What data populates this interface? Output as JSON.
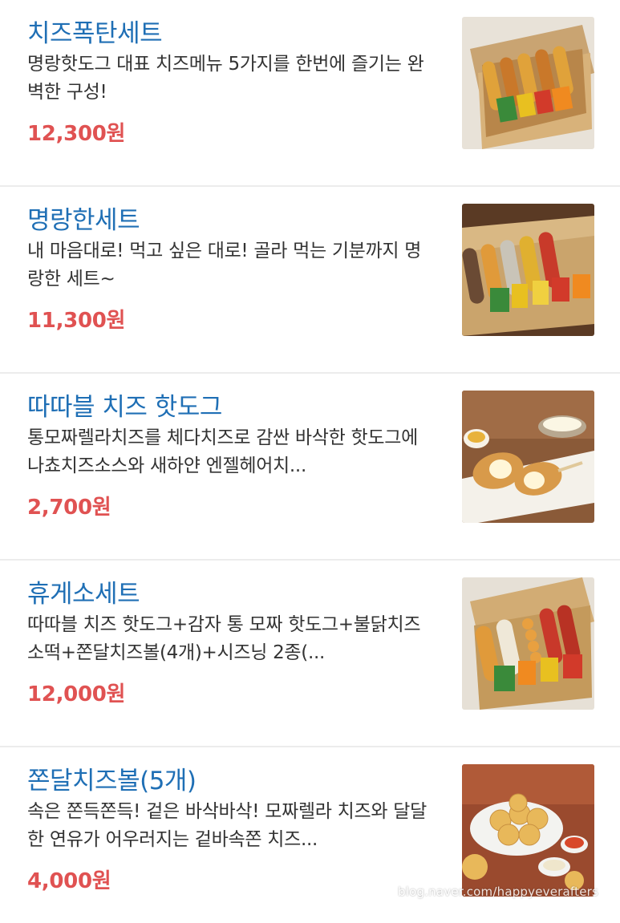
{
  "items": [
    {
      "name": "치즈폭탄세트",
      "description": "명랑핫도그 대표 치즈메뉴 5가지를 한번에 즐기는 완벽한 구성!",
      "price": "12,300원"
    },
    {
      "name": "명랑한세트",
      "description": "내 마음대로! 먹고 싶은 대로! 골라 먹는 기분까지 명랑한 세트~",
      "price": "11,300원"
    },
    {
      "name": "따따블 치즈 핫도그",
      "description": "통모짜렐라치즈를 체다치즈로 감싼 바삭한 핫도그에 나쵸치즈소스와 새하얀 엔젤헤어치...",
      "price": "2,700원"
    },
    {
      "name": "휴게소세트",
      "description": "따따블 치즈 핫도그+감자 통 모짜 핫도그+불닭치즈소떡+쫀달치즈볼(4개)+시즈닝 2종(...",
      "price": "12,000원"
    },
    {
      "name": "쫀달치즈볼(5개)",
      "description": "속은 쫀득쫀득! 겉은 바삭바삭! 모짜렐라 치즈와 달달한 연유가 어우러지는 겉바속쫀 치즈...",
      "price": "4,000원"
    }
  ],
  "watermark": "blog.naver.com/happyeverafters",
  "colors": {
    "name": "#1f6fb5",
    "price": "#e05252",
    "description": "#333333",
    "divider": "#ececec"
  }
}
